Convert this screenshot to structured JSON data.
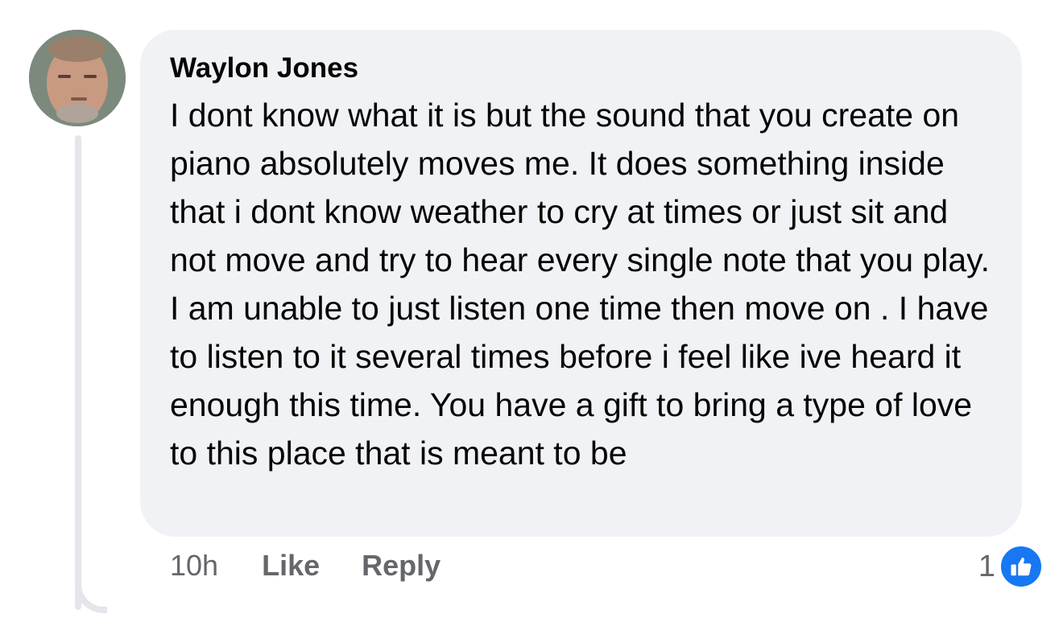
{
  "comment": {
    "author": "Waylon Jones",
    "text": "I dont know what it is but the sound that you create on piano absolutely moves me. It does something inside that i dont know weather to cry at times or just sit and not move and try to hear every single note that you play. I am unable to just listen one time then move on . I have to listen to it several times before i feel like ive heard it enough this time. You have a gift to bring a type of love to this place that is meant to be",
    "time": "10h",
    "like_label": "Like",
    "reply_label": "Reply",
    "reaction_count": "1",
    "reaction_icon": "thumbs-up-icon"
  },
  "colors": {
    "bubble_bg": "#f0f2f5",
    "text": "#050505",
    "meta": "#65676b",
    "like_blue": "#1877f2"
  }
}
